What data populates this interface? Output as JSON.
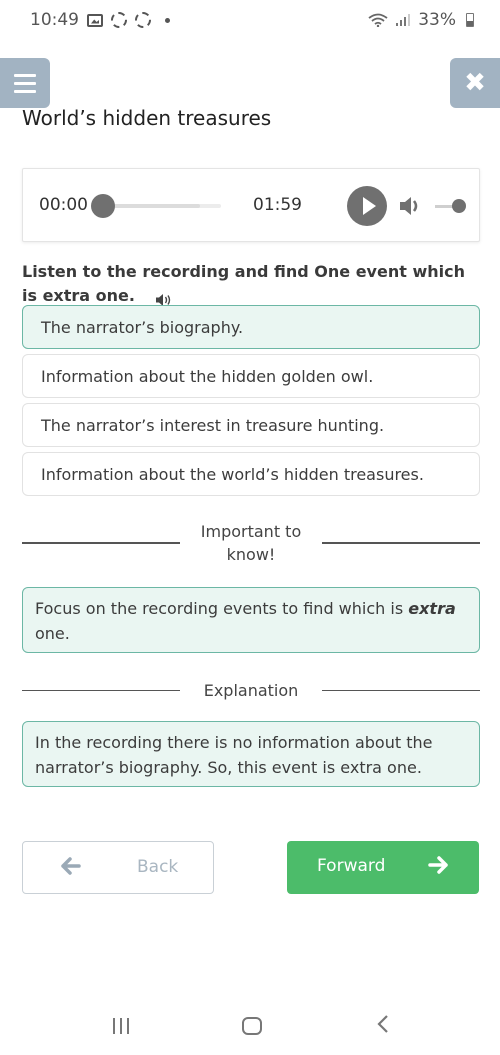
{
  "status_bar": {
    "time": "10:49",
    "battery": "33%",
    "icons": [
      "gallery-icon",
      "sync-icon",
      "sync-icon",
      "dot-icon",
      "wifi-icon",
      "signal-icon",
      "battery-icon"
    ]
  },
  "header": {
    "menu_icon": "hamburger-menu-icon",
    "close_icon": "close-icon",
    "close_glyph": "✖",
    "title": "World’s hidden treasures"
  },
  "audio_player": {
    "current_time": "00:00",
    "total_time": "01:59",
    "progress": 0,
    "buffered": 0.82,
    "volume": 1.0,
    "play_icon": "play-icon",
    "volume_icon": "volume-icon"
  },
  "question": {
    "text": "Listen to the recording and find One event which is extra one.",
    "speaker_icon": "speaker-icon"
  },
  "options": [
    {
      "label": "The narrator’s biography.",
      "selected": true
    },
    {
      "label": "Information about the hidden golden owl.",
      "selected": false
    },
    {
      "label": "The narrator’s interest in treasure hunting.",
      "selected": false
    },
    {
      "label": "Information about the world’s hidden treasures.",
      "selected": false
    }
  ],
  "important": {
    "heading_line1": "Important to",
    "heading_line2": "know!",
    "text_before": "Focus on the recording events to find which is ",
    "text_emphasis": "extra",
    "text_after": " one."
  },
  "explanation": {
    "heading": "Explanation",
    "text": "In the recording there is no information about the narrator’s biography. So, this event is extra one."
  },
  "navigation": {
    "back_label": "Back",
    "back_arrow": "🡐",
    "forward_label": "Forward",
    "forward_arrow": "➔"
  },
  "colors": {
    "header_button": "#a2b3c2",
    "selected_bg": "#eaf6f2",
    "selected_border": "#6cb7a5",
    "forward_button": "#4cbc6a",
    "player_gray": "#707070"
  }
}
